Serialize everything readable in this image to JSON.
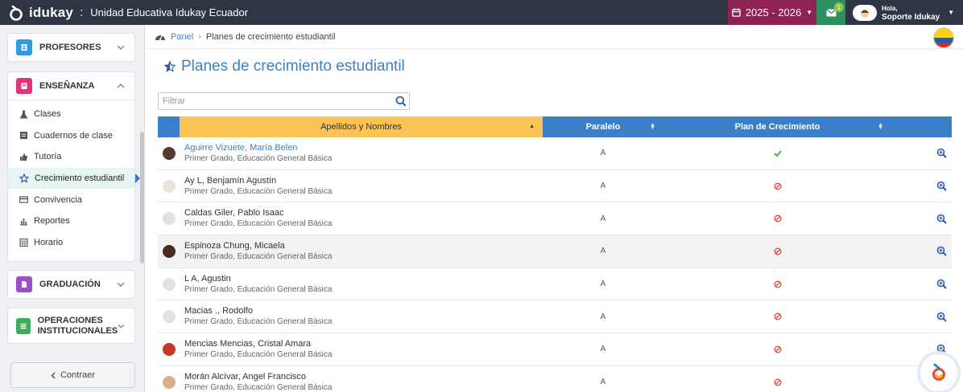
{
  "app": {
    "brand": "idukay",
    "separator": ":",
    "school": "Unidad Educativa Idukay Ecuador",
    "year": "2025 - 2026",
    "messages_badge": "1",
    "user_hello": "Hola,",
    "user_name": "Soporte Idukay",
    "colors": {
      "topbar": "#2f3542",
      "year": "#8c2352",
      "messages": "#2e8f5e",
      "accent": "#3d7fbf",
      "header_sorted": "#fbc454",
      "header": "#3a7fc8"
    }
  },
  "sidebar": {
    "profesores": "PROFESORES",
    "ensenanza": "ENSEÑANZA",
    "items": [
      {
        "label": "Clases",
        "icon": "flask-icon"
      },
      {
        "label": "Cuadernos de clase",
        "icon": "notebook-icon"
      },
      {
        "label": "Tutoría",
        "icon": "thumbs-up-icon"
      },
      {
        "label": "Crecimiento estudiantil",
        "icon": "star-icon"
      },
      {
        "label": "Convivencia",
        "icon": "card-icon"
      },
      {
        "label": "Reportes",
        "icon": "bar-chart-icon"
      },
      {
        "label": "Horario",
        "icon": "calendar-icon"
      }
    ],
    "graduacion": "GRADUACIÓN",
    "operaciones_1": "OPERACIONES",
    "operaciones_2": "INSTITUCIONALES",
    "collapse": "Contraer"
  },
  "breadcrumb": {
    "home": "Panel",
    "current": "Planes de crecimiento estudiantil"
  },
  "page": {
    "title": "Planes de crecimiento estudiantil",
    "filter_placeholder": "Filtrar"
  },
  "table": {
    "columns": [
      "Apellidos y Nombres",
      "Paralelo",
      "Plan de Crecimiento"
    ],
    "rows": [
      {
        "name": "Aguirre Vizuete, María Belen",
        "grade": "Primer Grado, Educación General Básica",
        "paralelo": "A",
        "plan": "yes"
      },
      {
        "name": "Ay L, Benjamín Agustín",
        "grade": "Primer Grado, Educación General Básica",
        "paralelo": "A",
        "plan": "no"
      },
      {
        "name": "Caldas Giler, Pablo Isaac",
        "grade": "Primer Grado, Educación General Básica",
        "paralelo": "A",
        "plan": "no"
      },
      {
        "name": "Espinoza Chung, Micaela",
        "grade": "Primer Grado, Educación General Básica",
        "paralelo": "A",
        "plan": "no"
      },
      {
        "name": "L A, Agustin",
        "grade": "Primer Grado, Educación General Básica",
        "paralelo": "A",
        "plan": "no"
      },
      {
        "name": "Macias ., Rodolfo",
        "grade": "Primer Grado, Educación General Básica",
        "paralelo": "A",
        "plan": "no"
      },
      {
        "name": "Mencias Mencias, Cristal Amara",
        "grade": "Primer Grado, Educación General Básica",
        "paralelo": "A",
        "plan": "no"
      },
      {
        "name": "Morán Alcívar, Angel Francisco",
        "grade": "Primer Grado, Educación General Básica",
        "paralelo": "A",
        "plan": "no"
      }
    ]
  }
}
